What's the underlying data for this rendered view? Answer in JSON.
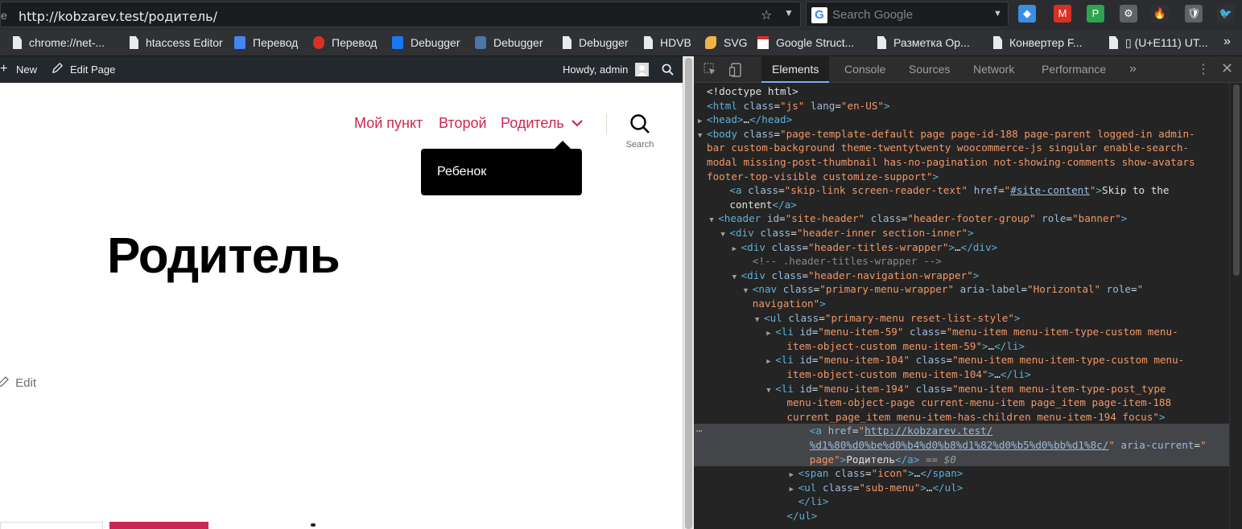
{
  "browser": {
    "url_prefix": "e",
    "url": "http://kobzarev.test/родитель/",
    "bookmark_star": "☆",
    "url_dropdown": "▼",
    "search_logo": "G",
    "search_placeholder": "Search Google",
    "search_dropdown": "▼",
    "extensions": [
      {
        "name": "cube-extension",
        "glyph": "◆",
        "color": "#3a8ee6"
      },
      {
        "name": "gmail-extension",
        "glyph": "M",
        "color": "#d93025"
      },
      {
        "name": "vpn-extension",
        "glyph": "P",
        "color": "#2ea44f"
      },
      {
        "name": "gear-extension",
        "glyph": "⚙",
        "color": "#5f6368"
      },
      {
        "name": "flame-extension",
        "glyph": "🔥",
        "color": "#303134"
      },
      {
        "name": "shield-extension",
        "glyph": "🛡",
        "color": "#5f6368"
      },
      {
        "name": "bird-extension",
        "glyph": "🐦",
        "color": "#303134"
      }
    ]
  },
  "bookmarks": [
    {
      "label": "chrome://net-...",
      "icon": "doc-icon"
    },
    {
      "label": "htaccess Editor",
      "icon": "doc-icon"
    },
    {
      "label": "Перевод",
      "icon": "google-translate-icon"
    },
    {
      "label": "Перевод",
      "icon": "translate-a-icon"
    },
    {
      "label": "Debugger",
      "icon": "facebook-icon"
    },
    {
      "label": "Debugger",
      "icon": "vk-icon"
    },
    {
      "label": "Debugger",
      "icon": "doc-icon"
    },
    {
      "label": "HDVB",
      "icon": "doc-icon"
    },
    {
      "label": "SVG",
      "icon": "rocket-icon"
    },
    {
      "label": "Google Struct...",
      "icon": "gmail-icon"
    },
    {
      "label": "Разметка Ор...",
      "icon": "doc-icon"
    },
    {
      "label": "Конвертер F...",
      "icon": "doc-icon"
    },
    {
      "label": "▯ (U+E111) UT...",
      "icon": "doc-icon"
    }
  ],
  "bookmarks_more": "»",
  "wp_admin_bar": {
    "new_label": "New",
    "edit_page_label": "Edit Page",
    "howdy_label": "Howdy, admin"
  },
  "site": {
    "nav": [
      "Мой пункт",
      "Второй",
      "Родитель"
    ],
    "nav_dropdown": "⌄",
    "search_label": "Search",
    "submenu_item": "Ребенок",
    "page_title": "Родитель",
    "edit_label": "Edit"
  },
  "devtools": {
    "tabs": [
      "Elements",
      "Console",
      "Sources",
      "Network",
      "Performance"
    ],
    "active_tab": "Elements",
    "more_tabs": "»",
    "menu": "⋮",
    "close": "✕",
    "selected_suffix": " == $0",
    "lines": [
      {
        "indent": 0,
        "tri": "",
        "html": "<span class='tx'>&lt;!doctype html&gt;</span>"
      },
      {
        "indent": 0,
        "tri": "",
        "html": "<span class='tg'>&lt;html</span> <span class='an'>class</span>=<span class='av'>\"js\"</span> <span class='an'>lang</span>=<span class='av'>\"en-US\"</span><span class='tg'>&gt;</span>"
      },
      {
        "indent": 0,
        "tri": "▶",
        "html": "<span class='tg'>&lt;head&gt;</span>…<span class='tg'>&lt;/head&gt;</span>"
      },
      {
        "indent": 0,
        "tri": "▼",
        "html": "<span class='tg'>&lt;body</span> <span class='an'>class</span>=<span class='av'>\"page-template-default page page-id-188 page-parent logged-in admin-</span>"
      },
      {
        "indent": 0,
        "tri": "",
        "html": "<span class='av'>bar custom-background theme-twentytwenty woocommerce-js singular enable-search-</span>"
      },
      {
        "indent": 0,
        "tri": "",
        "html": "<span class='av'>modal missing-post-thumbnail has-no-pagination not-showing-comments show-avatars</span>"
      },
      {
        "indent": 0,
        "tri": "",
        "html": "<span class='av'>footer-top-visible customize-support\"</span><span class='tg'>&gt;</span>"
      },
      {
        "indent": 2,
        "tri": "",
        "html": "<span class='tg'>&lt;a</span> <span class='an'>class</span>=<span class='av'>\"skip-link screen-reader-text\"</span> <span class='an'>href</span>=<span class='av'>\"</span><span class='un'>#site-content</span><span class='av'>\"</span><span class='tg'>&gt;</span><span class='tx'>Skip to the</span>"
      },
      {
        "indent": 2,
        "tri": "",
        "html": "<span class='tx'>content</span><span class='tg'>&lt;/a&gt;</span>"
      },
      {
        "indent": 1,
        "tri": "▼",
        "html": "<span class='tg'>&lt;header</span> <span class='an'>id</span>=<span class='av'>\"site-header\"</span> <span class='an'>class</span>=<span class='av'>\"header-footer-group\"</span> <span class='an'>role</span>=<span class='av'>\"banner\"</span><span class='tg'>&gt;</span>"
      },
      {
        "indent": 2,
        "tri": "▼",
        "html": "<span class='tg'>&lt;div</span> <span class='an'>class</span>=<span class='av'>\"header-inner section-inner\"</span><span class='tg'>&gt;</span>"
      },
      {
        "indent": 3,
        "tri": "▶",
        "html": "<span class='tg'>&lt;div</span> <span class='an'>class</span>=<span class='av'>\"header-titles-wrapper\"</span><span class='tg'>&gt;</span>…<span class='tg'>&lt;/div&gt;</span>"
      },
      {
        "indent": 4,
        "tri": "",
        "html": "<span class='cm'>&lt;!-- .header-titles-wrapper --&gt;</span>"
      },
      {
        "indent": 3,
        "tri": "▼",
        "html": "<span class='tg'>&lt;div</span> <span class='an'>class</span>=<span class='av'>\"header-navigation-wrapper\"</span><span class='tg'>&gt;</span>"
      },
      {
        "indent": 4,
        "tri": "▼",
        "html": "<span class='tg'>&lt;nav</span> <span class='an'>class</span>=<span class='av'>\"primary-menu-wrapper\"</span> <span class='an'>aria-label</span>=<span class='av'>\"Horizontal\"</span> <span class='an'>role</span>=<span class='av'>\"</span>"
      },
      {
        "indent": 4,
        "tri": "",
        "html": "<span class='av'>navigation\"</span><span class='tg'>&gt;</span>"
      },
      {
        "indent": 5,
        "tri": "▼",
        "html": "<span class='tg'>&lt;ul</span> <span class='an'>class</span>=<span class='av'>\"primary-menu reset-list-style\"</span><span class='tg'>&gt;</span>"
      },
      {
        "indent": 6,
        "tri": "▶",
        "html": "<span class='tg'>&lt;li</span> <span class='an'>id</span>=<span class='av'>\"menu-item-59\"</span> <span class='an'>class</span>=<span class='av'>\"menu-item menu-item-type-custom menu-</span>"
      },
      {
        "indent": 7,
        "tri": "",
        "html": "<span class='av'>item-object-custom menu-item-59\"</span><span class='tg'>&gt;</span>…<span class='tg'>&lt;/li&gt;</span>"
      },
      {
        "indent": 6,
        "tri": "▶",
        "html": "<span class='tg'>&lt;li</span> <span class='an'>id</span>=<span class='av'>\"menu-item-104\"</span> <span class='an'>class</span>=<span class='av'>\"menu-item menu-item-type-custom menu-</span>"
      },
      {
        "indent": 7,
        "tri": "",
        "html": "<span class='av'>item-object-custom menu-item-104\"</span><span class='tg'>&gt;</span>…<span class='tg'>&lt;/li&gt;</span>"
      },
      {
        "indent": 6,
        "tri": "▼",
        "html": "<span class='tg'>&lt;li</span> <span class='an'>id</span>=<span class='av'>\"menu-item-194\"</span> <span class='an'>class</span>=<span class='av'>\"menu-item menu-item-type-post_type</span>"
      },
      {
        "indent": 7,
        "tri": "",
        "html": "<span class='av'>menu-item-object-page current-menu-item page_item page-item-188</span>"
      },
      {
        "indent": 7,
        "tri": "",
        "html": "<span class='av'>current_page_item menu-item-has-children menu-item-194 focus\"</span><span class='tg'>&gt;</span>"
      },
      {
        "indent": 9,
        "tri": "",
        "sel": true,
        "html": "<span class='tg'>&lt;a</span> <span class='an'>href</span>=<span class='av'>\"</span><span class='un'>http://kobzarev.test/</span>"
      },
      {
        "indent": 9,
        "tri": "",
        "sel": true,
        "html": "<span class='un'>%d1%80%d0%be%d0%b4%d0%b8%d1%82%d0%b5%d0%bb%d1%8c/</span><span class='av'>\"</span> <span class='an'>aria-current</span>=<span class='av'>\"</span>"
      },
      {
        "indent": 9,
        "tri": "",
        "sel": true,
        "html": "<span class='av'>page\"</span><span class='tg'>&gt;</span><span class='tx'>Родитель</span><span class='tg'>&lt;/a&gt;</span><span class='dim'> == $0</span>"
      },
      {
        "indent": 8,
        "tri": "▶",
        "html": "<span class='tg'>&lt;span</span> <span class='an'>class</span>=<span class='av'>\"icon\"</span><span class='tg'>&gt;</span>…<span class='tg'>&lt;/span&gt;</span>"
      },
      {
        "indent": 8,
        "tri": "▶",
        "html": "<span class='tg'>&lt;ul</span> <span class='an'>class</span>=<span class='av'>\"sub-menu\"</span><span class='tg'>&gt;</span>…<span class='tg'>&lt;/ul&gt;</span>"
      },
      {
        "indent": 8,
        "tri": "",
        "html": "<span class='tg'>&lt;/li&gt;</span>"
      },
      {
        "indent": 7,
        "tri": "",
        "html": "<span class='tg'>&lt;/ul&gt;</span>"
      }
    ]
  }
}
